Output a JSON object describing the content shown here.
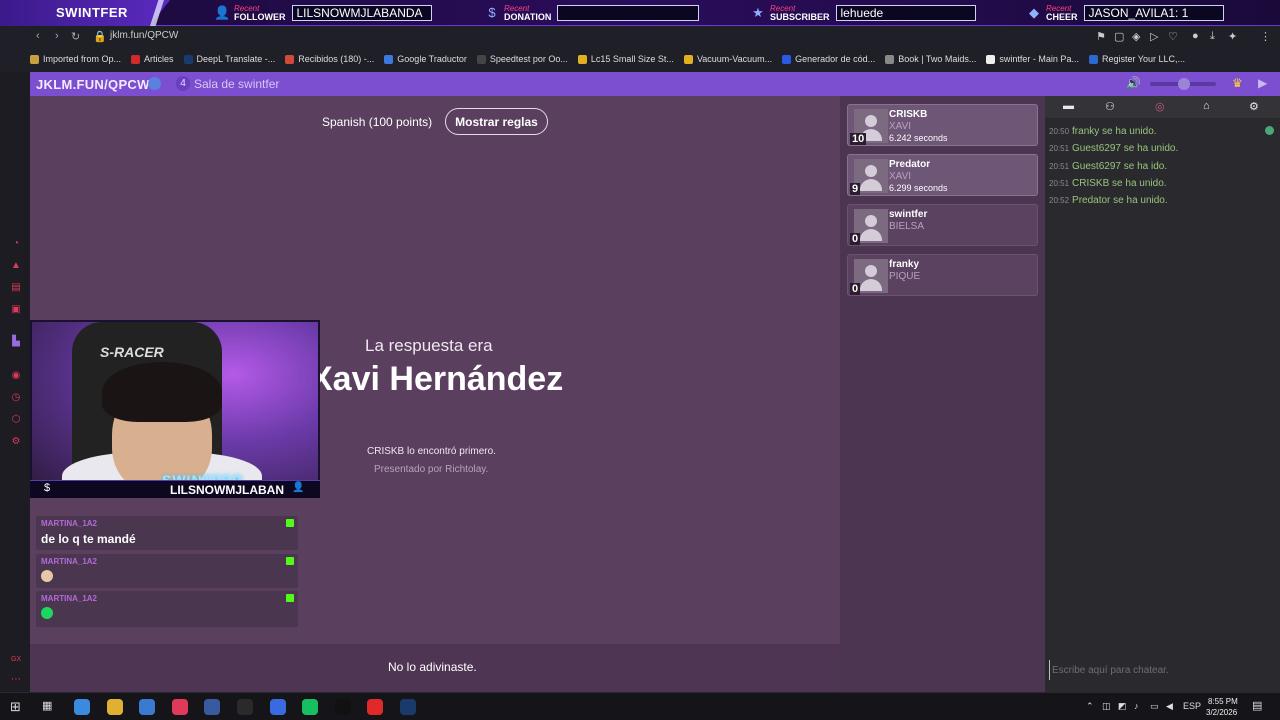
{
  "overlay": {
    "brand": "SWINTFER",
    "recent_word": "Recent",
    "groups": [
      {
        "icon": "follower-icon",
        "glyph": "👤",
        "label": "FOLLOWER",
        "value": "LILSNOWMJLABANDA"
      },
      {
        "icon": "donation-icon",
        "glyph": "$",
        "label": "DONATION",
        "value": ""
      },
      {
        "icon": "subscriber-icon",
        "glyph": "★",
        "label": "SUBSCRIBER",
        "value": "lehuede"
      },
      {
        "icon": "cheer-icon",
        "glyph": "◆",
        "label": "CHEER",
        "value": "JASON_AVILA1: 1"
      }
    ]
  },
  "browser": {
    "url": "jklm.fun/QPCW",
    "bookmarks": [
      {
        "label": "Imported from Op...",
        "color": "#c9a040"
      },
      {
        "label": "Articles",
        "color": "#d02a2a"
      },
      {
        "label": "DeepL Translate -...",
        "color": "#1a3a6a"
      },
      {
        "label": "Recibidos (180) -...",
        "color": "#d04a3a"
      },
      {
        "label": "Google Traductor",
        "color": "#3a7ae0"
      },
      {
        "label": "Speedtest por Oo...",
        "color": "#444"
      },
      {
        "label": "Lc15 Small Size St...",
        "color": "#e0b020"
      },
      {
        "label": "Vacuum-Vacuum...",
        "color": "#e0b020"
      },
      {
        "label": "Generador de cód...",
        "color": "#2a5ae0"
      },
      {
        "label": "Book | Two Maids...",
        "color": "#888"
      },
      {
        "label": "swintfer - Main Pa...",
        "color": "#eee"
      },
      {
        "label": "Register Your LLC,...",
        "color": "#2a6ad0"
      }
    ]
  },
  "header": {
    "site_title": "JKLM.FUN/QPCW",
    "room_count": "4",
    "room_name": "Sala de swintfer"
  },
  "game": {
    "language_label": "Spanish (100 points)",
    "rules_button": "Mostrar reglas",
    "answer_caption": "La respuesta era",
    "answer": "Xavi Hernández",
    "found_first": "CRISKB lo encontró primero.",
    "presented_by": "Presentado por Richtolay.",
    "miss_message": "No lo adivinaste."
  },
  "webcam": {
    "chair_brand": "S-RACER",
    "overlay_label": "SWINTFER",
    "bar_name": "LILSNOWMJLABAN"
  },
  "twitch_chat": [
    {
      "user": "MARTINA_1A2",
      "text": "de lo q te mandé",
      "emoji": null
    },
    {
      "user": "MARTINA_1A2",
      "text": "",
      "emoji": "#e6c8a8"
    },
    {
      "user": "MARTINA_1A2",
      "text": "",
      "emoji": "#1ed760"
    }
  ],
  "players": [
    {
      "score": "10",
      "name": "CRISKB",
      "guess": "XAVI",
      "time": "6.242 seconds",
      "active": true
    },
    {
      "score": "9",
      "name": "Predator",
      "guess": "XAVI",
      "time": "6.299 seconds",
      "active": true
    },
    {
      "score": "0",
      "name": "swintfer",
      "guess": "BIELSA",
      "time": "",
      "active": false
    },
    {
      "score": "0",
      "name": "franky",
      "guess": "PIQUE",
      "time": "",
      "active": false
    }
  ],
  "chat": {
    "messages": [
      {
        "time": "20:50",
        "text": "franky se ha unido."
      },
      {
        "time": "20:51",
        "text": "Guest6297 se ha unido."
      },
      {
        "time": "20:51",
        "text": "Guest6297 se ha ido."
      },
      {
        "time": "20:51",
        "text": "CRISKB se ha unido."
      },
      {
        "time": "20:52",
        "text": "Predator se ha unido."
      }
    ],
    "input_placeholder": "Escribe aquí para chatear."
  },
  "taskbar": {
    "time": "8:55 PM",
    "date": "3/2/2026",
    "lang": "ESP",
    "notif_count": "3",
    "apps": [
      "#3a8ae0",
      "#e0b030",
      "#3a7ad0",
      "#e03a5a",
      "#3a5aa0",
      "#2a2a2a",
      "#3a6ae0",
      "#16c060",
      "#111",
      "#e02a2a",
      "#1a3a6a"
    ]
  },
  "colors": {
    "accent": "#7b4fd0",
    "game_bg": "#5a3f5f",
    "chat_bg": "#2a2a2e",
    "chat_msg": "#98c47c"
  }
}
